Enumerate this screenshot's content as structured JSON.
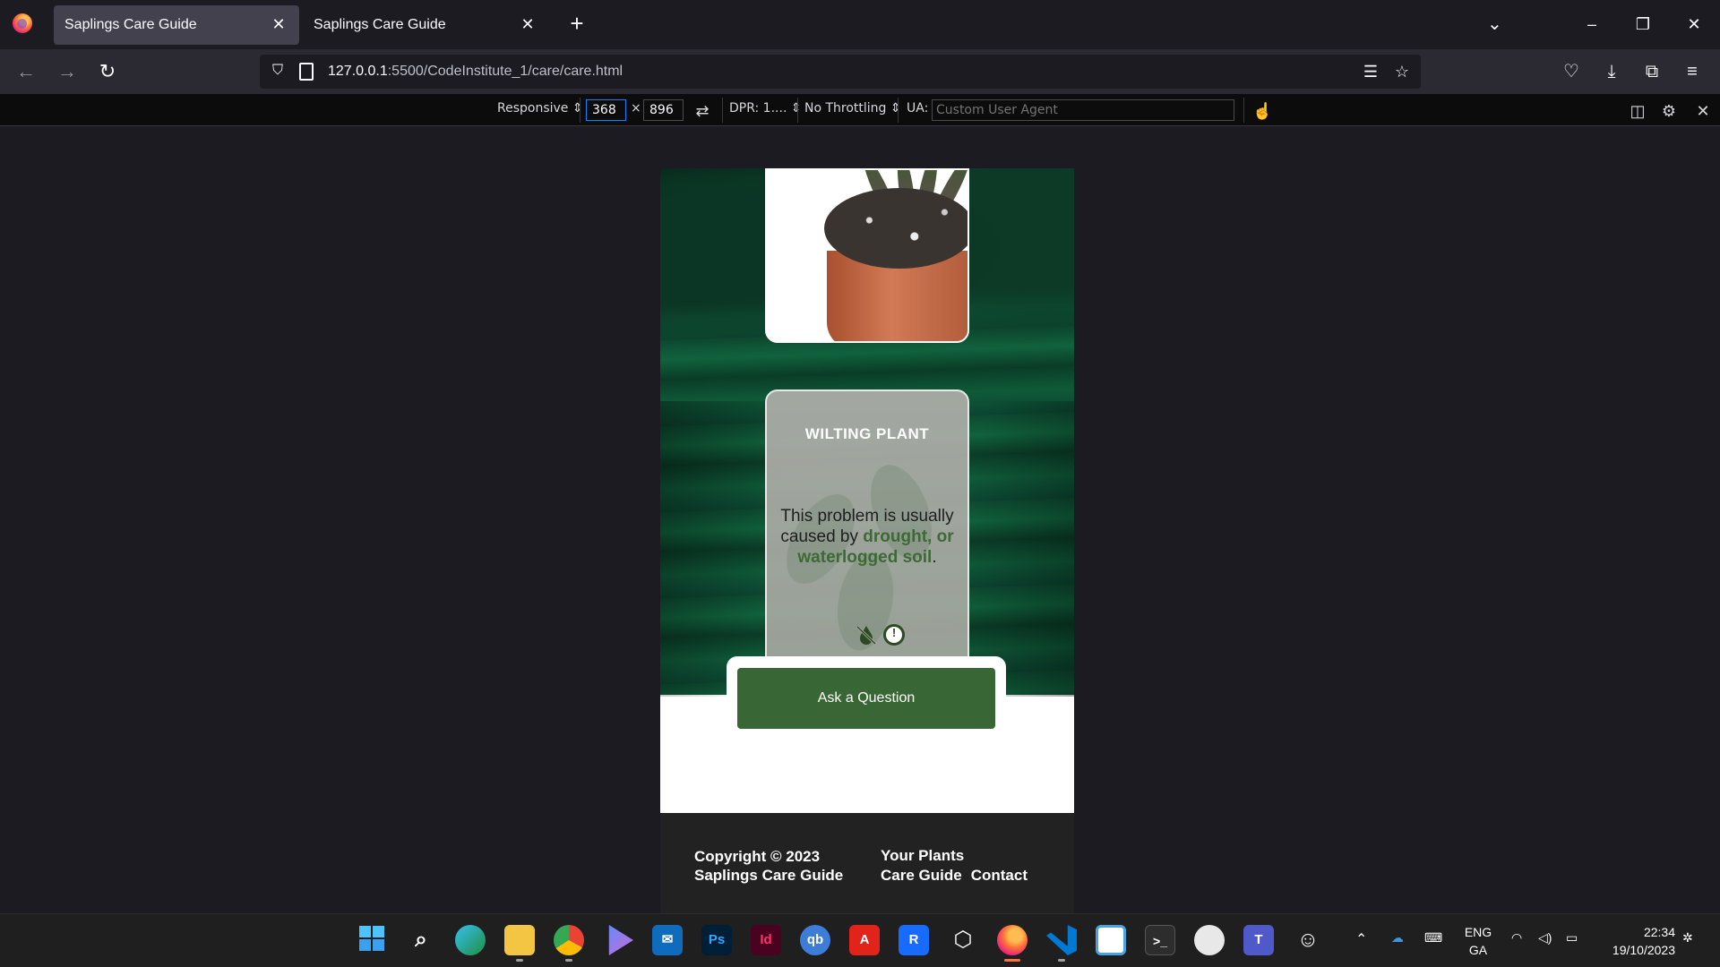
{
  "browser": {
    "tabs": [
      {
        "title": "Saplings Care Guide",
        "active": true
      },
      {
        "title": "Saplings Care Guide",
        "active": false
      }
    ],
    "url_host": "127.0.0.1",
    "url_rest": ":5500/CodeInstitute_1/care/care.html"
  },
  "rdm": {
    "device": "Responsive",
    "width": "368",
    "times": "×",
    "height": "896",
    "dpr": "DPR: 1....",
    "throttling": "No Throttling",
    "ua_label": "UA:",
    "ua_placeholder": "Custom User Agent"
  },
  "page": {
    "card_title": "WILTING PLANT",
    "card_text_prefix": "This problem is usually caused by ",
    "card_text_highlight": "drought, or waterlogged soil",
    "card_text_suffix": ".",
    "ask_button": "Ask a Question",
    "footer": {
      "copyright_line1": "Copyright © 2023",
      "copyright_line2": "Saplings Care Guide",
      "links": [
        "Your Plants",
        "Care Guide",
        "Contact"
      ]
    }
  },
  "taskbar": {
    "apps": [
      "start-icon",
      "search-icon",
      "edge-icon",
      "file-explorer-icon",
      "chrome-icon",
      "copilot-icon",
      "mail-icon",
      "photoshop-icon",
      "indesign-icon",
      "qbittorrent-icon",
      "autocad-icon",
      "revit-icon",
      "3d-viewer-icon",
      "firefox-icon",
      "vscode-icon",
      "notepad-icon",
      "terminal-icon",
      "app-icon",
      "teams-icon",
      "emoji-icon"
    ],
    "app_labels": {
      "photoshop": "Ps",
      "indesign": "Id",
      "qbittorrent": "qb",
      "autocad": "A",
      "revit": "R"
    },
    "lang_top": "ENG",
    "lang_bottom": "GA",
    "time": "22:34",
    "date": "19/10/2023"
  },
  "colors": {
    "button_green": "#386634",
    "highlight_green": "#3c6a34",
    "footer_bg": "#222222",
    "browser_bg": "#1c1b22"
  }
}
